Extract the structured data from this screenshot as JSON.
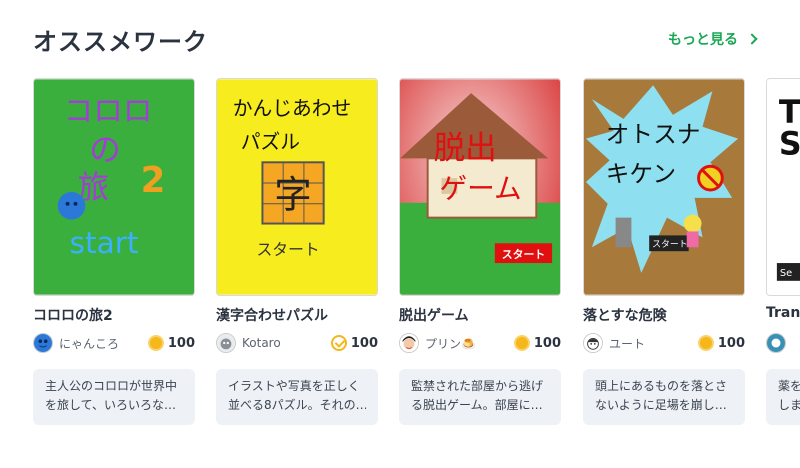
{
  "section": {
    "title": "オススメワーク",
    "more_label": "もっと見る"
  },
  "cards": [
    {
      "title": "コロロの旅2",
      "author": "にゃんころ",
      "score": "100",
      "score_icon": "coin-icon",
      "desc_line1": "主人公のコロロが世界中",
      "desc_line2": "を旅して、いろいろな…",
      "thumb_text1": "コロロ",
      "thumb_text2": "の",
      "thumb_text3": "旅",
      "thumb_text4": "2",
      "thumb_text5": "start"
    },
    {
      "title": "漢字合わせパズル",
      "author": "Kotaro",
      "score": "100",
      "score_icon": "check-icon",
      "desc_line1": "イラストや写真を正しく",
      "desc_line2": "並べる8パズル。それの…",
      "thumb_text1": "かんじあわせ",
      "thumb_text2": "パズル",
      "thumb_text3": "字",
      "thumb_text4": "スタート"
    },
    {
      "title": "脱出ゲーム",
      "author": "プリン🍮",
      "score": "100",
      "score_icon": "coin-icon",
      "desc_line1": "監禁された部屋から逃げ",
      "desc_line2": "る脱出ゲーム。部屋に…",
      "thumb_text1": "脱出",
      "thumb_text2": "ゲーム",
      "thumb_text3": "スタート"
    },
    {
      "title": "落とすな危険",
      "author": "ユート",
      "score": "100",
      "score_icon": "coin-icon",
      "desc_line1": "頭上にあるものを落とさ",
      "desc_line2": "ないように足場を崩し…",
      "thumb_text1": "オトスナ",
      "thumb_text2": "キケン",
      "thumb_text3": "スタート"
    },
    {
      "title": "Tran",
      "author": "",
      "score": "",
      "score_icon": "",
      "desc_line1": "薬を",
      "desc_line2": "しま",
      "thumb_text1": "T",
      "thumb_text2": "S",
      "thumb_text3": "Se"
    }
  ],
  "colors": {
    "accent": "#1aa653",
    "coin": "#f5b71a",
    "desc_bg": "#eef1f5"
  }
}
